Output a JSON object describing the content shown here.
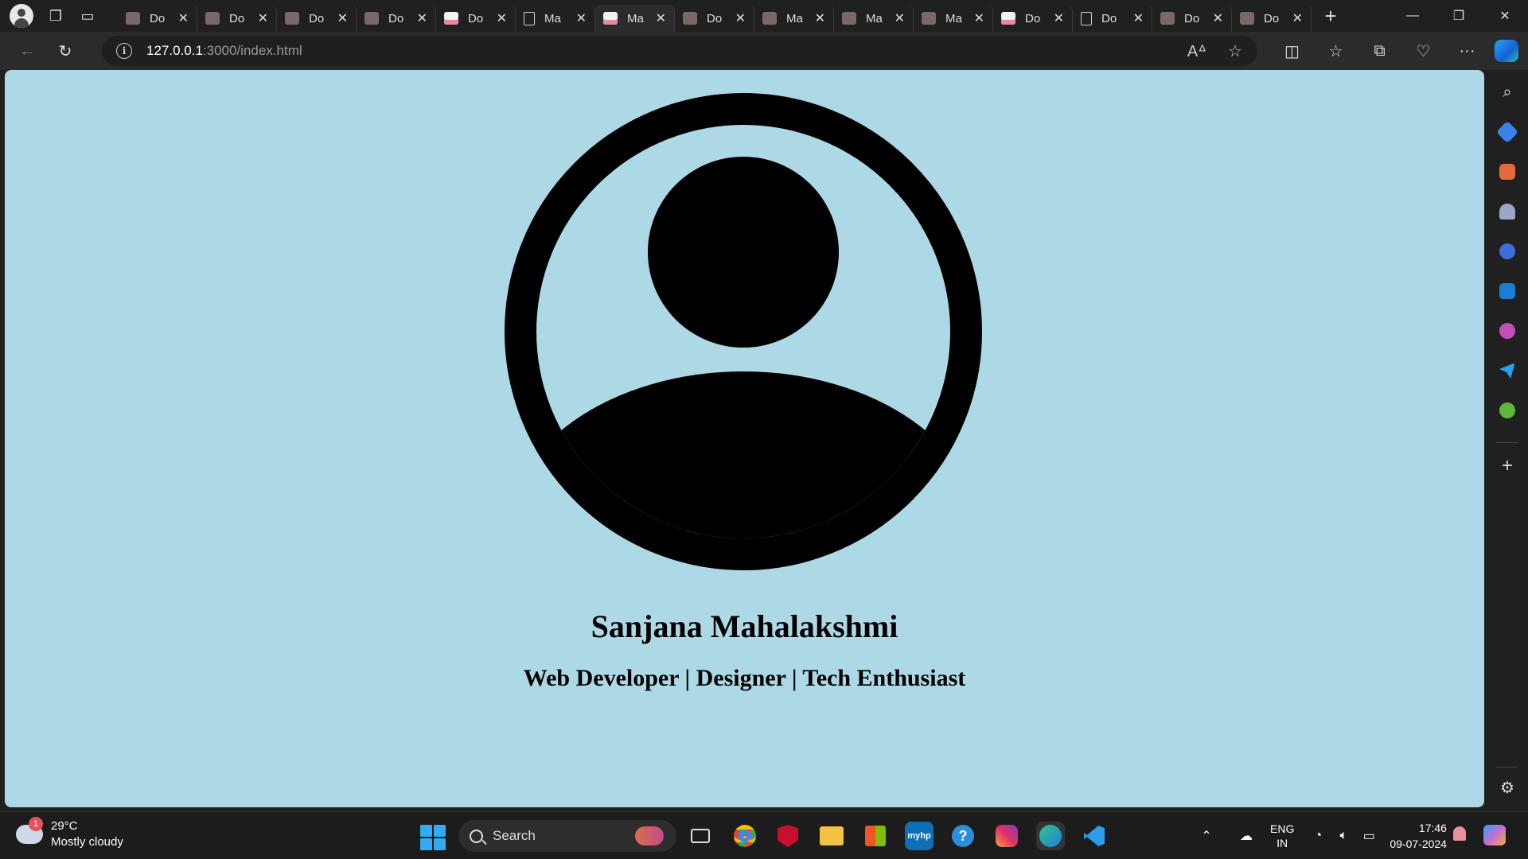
{
  "browser": {
    "tabs": [
      {
        "title": "Do",
        "favicon": "page-favicon",
        "active": false
      },
      {
        "title": "Do",
        "favicon": "page-favicon",
        "active": false
      },
      {
        "title": "Do",
        "favicon": "page-favicon",
        "active": false
      },
      {
        "title": "Do",
        "favicon": "page-favicon",
        "active": false
      },
      {
        "title": "Do",
        "favicon": "pink-favicon",
        "active": false
      },
      {
        "title": "Ma",
        "favicon": "document-favicon",
        "active": false
      },
      {
        "title": "Ma",
        "favicon": "pink-favicon",
        "active": true
      },
      {
        "title": "Do",
        "favicon": "page-favicon",
        "active": false
      },
      {
        "title": "Ma",
        "favicon": "page-favicon",
        "active": false
      },
      {
        "title": "Ma",
        "favicon": "page-favicon",
        "active": false
      },
      {
        "title": "Ma",
        "favicon": "page-favicon",
        "active": false
      },
      {
        "title": "Do",
        "favicon": "pink-favicon",
        "active": false
      },
      {
        "title": "Do",
        "favicon": "document-favicon",
        "active": false
      },
      {
        "title": "Do",
        "favicon": "page-favicon",
        "active": false
      },
      {
        "title": "Do",
        "favicon": "page-favicon",
        "active": false
      }
    ],
    "tab_close_glyph": "✕",
    "new_tab_glyph": "+",
    "address": {
      "host": "127.0.0.1",
      "path": ":3000/index.html"
    },
    "window_controls": {
      "minimize": "—",
      "restore": "❐",
      "close": "✕"
    }
  },
  "page": {
    "background": "#add8e6",
    "avatar_icon": "user-avatar-icon",
    "name": "Sanjana Mahalakshmi",
    "tagline": "Web Developer | Designer | Tech Enthusiast"
  },
  "taskbar": {
    "weather": {
      "badge": "1",
      "temperature": "29°C",
      "condition": "Mostly cloudy"
    },
    "search_placeholder": "Search",
    "language": {
      "line1": "ENG",
      "line2": "IN"
    },
    "clock": {
      "time": "17:46",
      "date": "09-07-2024"
    },
    "myhp_label": "myhp"
  }
}
